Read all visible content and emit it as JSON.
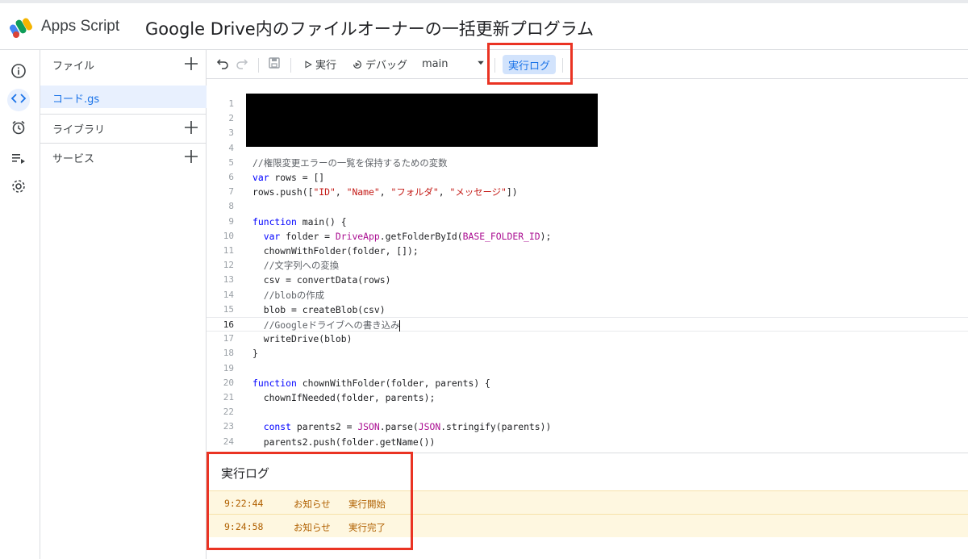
{
  "header": {
    "app_name": "Apps Script",
    "project_title": "Google Drive内のファイルオーナーの一括更新プログラム"
  },
  "rail": {
    "items": [
      "info-icon",
      "code-icon",
      "alarm-clock-icon",
      "executions-icon",
      "settings-icon"
    ],
    "active": "code-icon"
  },
  "files": {
    "files_label": "ファイル",
    "file_name": "コード.gs",
    "libraries_label": "ライブラリ",
    "services_label": "サービス"
  },
  "toolbar": {
    "run_label": "実行",
    "debug_label": "デバッグ",
    "function_select": "main",
    "run_log_label": "実行ログ"
  },
  "editor": {
    "current_line": 16,
    "lines": [
      {
        "n": "1",
        "code": ""
      },
      {
        "n": "2",
        "code": ""
      },
      {
        "n": "3",
        "code": ""
      },
      {
        "n": "4",
        "code": ""
      },
      {
        "n": "5",
        "code": "//権限変更エラーの一覧を保持するための変数"
      },
      {
        "n": "6",
        "code": "var rows = []"
      },
      {
        "n": "7",
        "code": "rows.push([\"ID\", \"Name\", \"フォルダ\", \"メッセージ\"])"
      },
      {
        "n": "8",
        "code": ""
      },
      {
        "n": "9",
        "code": "function main() {"
      },
      {
        "n": "10",
        "code": "  var folder = DriveApp.getFolderById(BASE_FOLDER_ID);"
      },
      {
        "n": "11",
        "code": "  chownWithFolder(folder, []);"
      },
      {
        "n": "12",
        "code": "  //文字列への変換"
      },
      {
        "n": "13",
        "code": "  csv = convertData(rows)"
      },
      {
        "n": "14",
        "code": "  //blobの作成"
      },
      {
        "n": "15",
        "code": "  blob = createBlob(csv)"
      },
      {
        "n": "16",
        "code": "  //Googleドライブへの書き込み"
      },
      {
        "n": "17",
        "code": "  writeDrive(blob)"
      },
      {
        "n": "18",
        "code": "}"
      },
      {
        "n": "19",
        "code": ""
      },
      {
        "n": "20",
        "code": "function chownWithFolder(folder, parents) {"
      },
      {
        "n": "21",
        "code": "  chownIfNeeded(folder, parents);"
      },
      {
        "n": "22",
        "code": ""
      },
      {
        "n": "23",
        "code": "  const parents2 = JSON.parse(JSON.stringify(parents))"
      },
      {
        "n": "24",
        "code": "  parents2.push(folder.getName())"
      }
    ]
  },
  "log": {
    "title": "実行ログ",
    "entries": [
      {
        "time": "9:22:44",
        "level": "お知らせ",
        "message": "実行開始"
      },
      {
        "time": "9:24:58",
        "level": "お知らせ",
        "message": "実行完了"
      }
    ]
  },
  "colors": {
    "accent": "#1a73e8",
    "highlight_box": "#ea3323",
    "log_bg": "#fef7e0",
    "log_text": "#b06000"
  }
}
